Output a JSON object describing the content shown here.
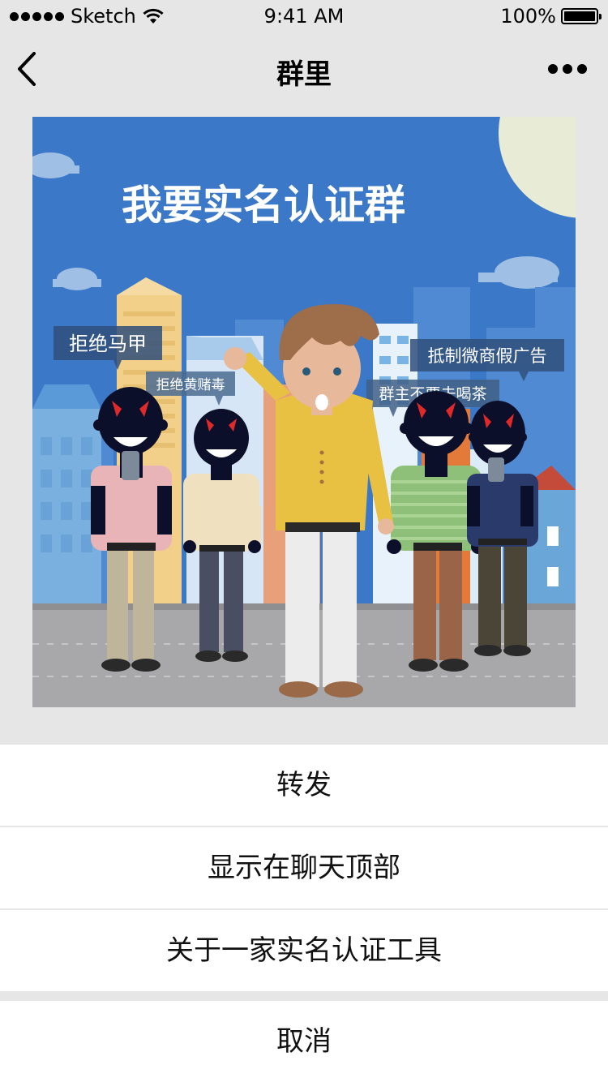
{
  "status_bar": {
    "carrier": "Sketch",
    "time": "9:41 AM",
    "battery": "100%"
  },
  "nav": {
    "title": "群里",
    "back_icon": "chevron-left-icon",
    "more_icon": "more-dots-icon"
  },
  "poster": {
    "headline": "我要实名认证群",
    "bubbles": [
      "拒绝马甲",
      "拒绝黄赌毒",
      "抵制微商假广告",
      "群主不要去喝茶"
    ]
  },
  "action_sheet": {
    "items": [
      "转发",
      "显示在聊天顶部",
      "关于一家实名认证工具"
    ],
    "cancel": "取消"
  },
  "colors": {
    "sky": "#3c78c8",
    "background": "#e6e6e6",
    "sheet": "#ffffff"
  }
}
